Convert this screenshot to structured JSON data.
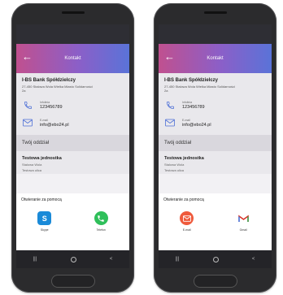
{
  "phones": [
    {
      "appbar": {
        "title": "Kontakt",
        "back_glyph": "←"
      },
      "bank": {
        "name": "I-BS Bank Spółdzielczy",
        "address": "27-450 Stalowa Wola Wielka Miasto Solidarności 2a"
      },
      "contacts": [
        {
          "label": "Infolinia",
          "value": "123456789",
          "icon": "phone-icon"
        },
        {
          "label": "E-mail",
          "value": "info@ebo24.pl",
          "icon": "mail-icon"
        }
      ],
      "section_title": "Twój oddział",
      "unit": {
        "name": "Testowa jednostka",
        "line1": "Stalowa Wola",
        "line2": "Testowa ulica"
      },
      "sheet": {
        "title": "Otwieranie za pomocą",
        "apps": [
          {
            "label": "Skype",
            "icon": "skype-icon",
            "color": "#1a8ad8"
          },
          {
            "label": "Telefon",
            "icon": "phone-app-icon",
            "color": "#2fbf5a"
          }
        ]
      },
      "navbar": {
        "recents": "|||",
        "back": "<"
      }
    },
    {
      "appbar": {
        "title": "Kontakt",
        "back_glyph": "←"
      },
      "bank": {
        "name": "I-BS Bank Spółdzielczy",
        "address": "27-450 Stalowa Wola Wielka Miasto Solidarności 2a"
      },
      "contacts": [
        {
          "label": "Infolinia",
          "value": "123456789",
          "icon": "phone-icon"
        },
        {
          "label": "E-mail",
          "value": "info@ebo24.pl",
          "icon": "mail-icon"
        }
      ],
      "section_title": "Twój oddział",
      "unit": {
        "name": "Testowa jednostka",
        "line1": "Stalowa Wola",
        "line2": "Testowa ulica"
      },
      "sheet": {
        "title": "Otwieranie za pomocą",
        "apps": [
          {
            "label": "E-mail",
            "icon": "email-app-icon",
            "color": "#ef5a3c"
          },
          {
            "label": "Gmail",
            "icon": "gmail-icon",
            "color": "#ffffff"
          }
        ]
      },
      "navbar": {
        "recents": "|||",
        "back": "<"
      }
    }
  ]
}
